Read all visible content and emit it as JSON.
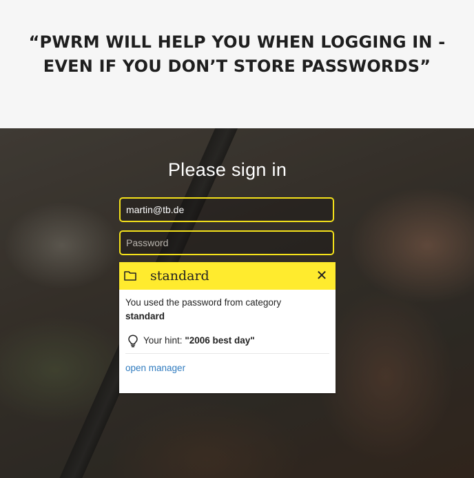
{
  "headline": {
    "line1": "“PWRM WILL HELP YOU WHEN LOGGING IN -",
    "line2": "EVEN IF YOU DON’T STORE PASSWORDS”"
  },
  "login": {
    "title": "Please sign in",
    "email_value": "martin@tb.de",
    "password_placeholder": "Password"
  },
  "popup": {
    "icon": "folder-icon",
    "category": "standard",
    "close_symbol": "✕",
    "message": "You used the password from category",
    "message_category": "standard",
    "hint_label": "Your hint:",
    "hint_value": "\"2006 best day\"",
    "link_label": "open manager"
  },
  "colors": {
    "accent": "#ffeb2e",
    "field_border": "#f5e21a",
    "link": "#2f7bbf"
  }
}
